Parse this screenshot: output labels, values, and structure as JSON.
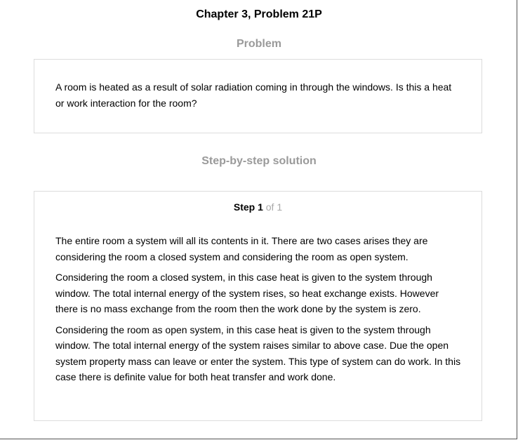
{
  "page": {
    "title": "Chapter 3, Problem 21P"
  },
  "problem": {
    "heading": "Problem",
    "text": "A room is heated as a result of solar radiation coming in through the windows. Is this a heat or work interaction for the room?"
  },
  "solution": {
    "heading": "Step-by-step solution",
    "step": {
      "label": "Step 1",
      "of_text": "of 1"
    },
    "paragraphs": [
      "The entire room a system will all its contents in it. There are two cases arises they are considering the room a closed system and considering the room as open system.",
      "Considering the room a closed system, in this case heat is given to the system through window. The total internal energy of the system rises, so heat exchange exists. However there is no mass exchange from the room then the work done by the system is zero.",
      "Considering the room as open system, in this case heat is given to the system through window. The total internal energy of the system raises similar to above case. Due the open system property mass can leave or enter the system. This type of system can do work. In this case there is definite value for both heat transfer and work done."
    ]
  }
}
